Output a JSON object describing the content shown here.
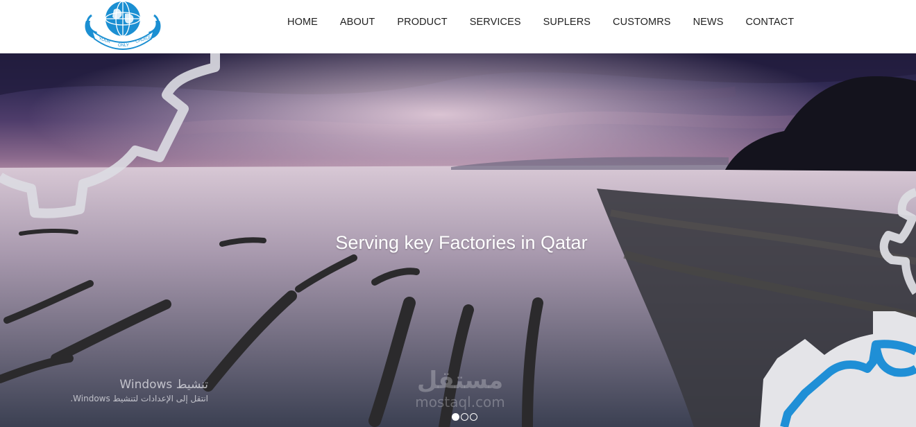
{
  "brand": {
    "logo_text": [
      "YOUR",
      "ONLY",
      "CHOICE"
    ],
    "primary_color": "#1b8fd2"
  },
  "nav": {
    "items": [
      "HOME",
      "ABOUT",
      "PRODUCT",
      "SERVICES",
      "SUPLERS",
      "CUSTOMRS",
      "NEWS",
      "CONTACT"
    ]
  },
  "hero": {
    "caption": "Serving key Factories in Qatar",
    "slides_total": 3,
    "active_slide": 1
  },
  "overlay": {
    "windows_title": "تنشيط Windows",
    "windows_subtitle": "انتقل إلى الإعدادات لتنشيط Windows.",
    "watermark_ar": "مستقل",
    "watermark_en": "mostaql.com"
  },
  "colors": {
    "gear_outline": "#dcdce2",
    "gear_fill": "#e4e4e8",
    "gear_accent": "#1f8fd6"
  }
}
